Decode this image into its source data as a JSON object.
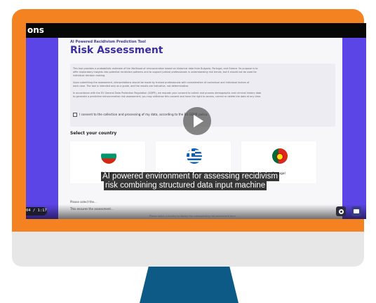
{
  "video": {
    "title_fragment": "ons",
    "timestamp": "04 / 1:17",
    "captions": [
      "AI powered environment for assessing recidivism",
      "risk combining structured data input machine"
    ]
  },
  "page": {
    "tool_name": "AI Powered Recidivism Prediction Tool",
    "title": "Risk Assessment",
    "info_lines": [
      "This tool provides a probabilistic estimate of the likelihood of reincarceration based on historical data from Bulgaria, Portugal, and Greece. Its purpose is to",
      "offer exploratory insights into potential recidivism patterns and to support judicial professionals in understanding risk trends, but it should not be used for",
      "individual decision making.",
      "Upon submitting the assessment, interpretations should be made by trained professionals with consideration of contextual and individual factors of",
      "each case. The tool is intended only as a guide, and the results are indicative, not determinative.",
      "In accordance with the EU General Data Protection Regulation (GDPR), we request your consent to collect and process demographic and criminal history data",
      "to generate a predictive reincarceration risk assessment; you may withdraw this consent and have the right to access, correct or delete the data at any time."
    ],
    "consent_label": "I consent to the collection and processing of my data, according to the EU GDPR policy.",
    "select_label": "Select your country",
    "countries": [
      "Bulgaria",
      "Greece",
      "Portugal"
    ],
    "under_text_1": "Please select the...",
    "under_text_2": "This ensures the assessment...",
    "bottom_note": "Please select a country to display the corresponding risk assessment form."
  },
  "colors": {
    "frame": "#f58220",
    "screen_bg": "#5b45e6",
    "title": "#3b2fa0",
    "stand": "#0e5a86"
  },
  "icons": [
    "play-icon",
    "settings-icon",
    "captions-icon"
  ]
}
